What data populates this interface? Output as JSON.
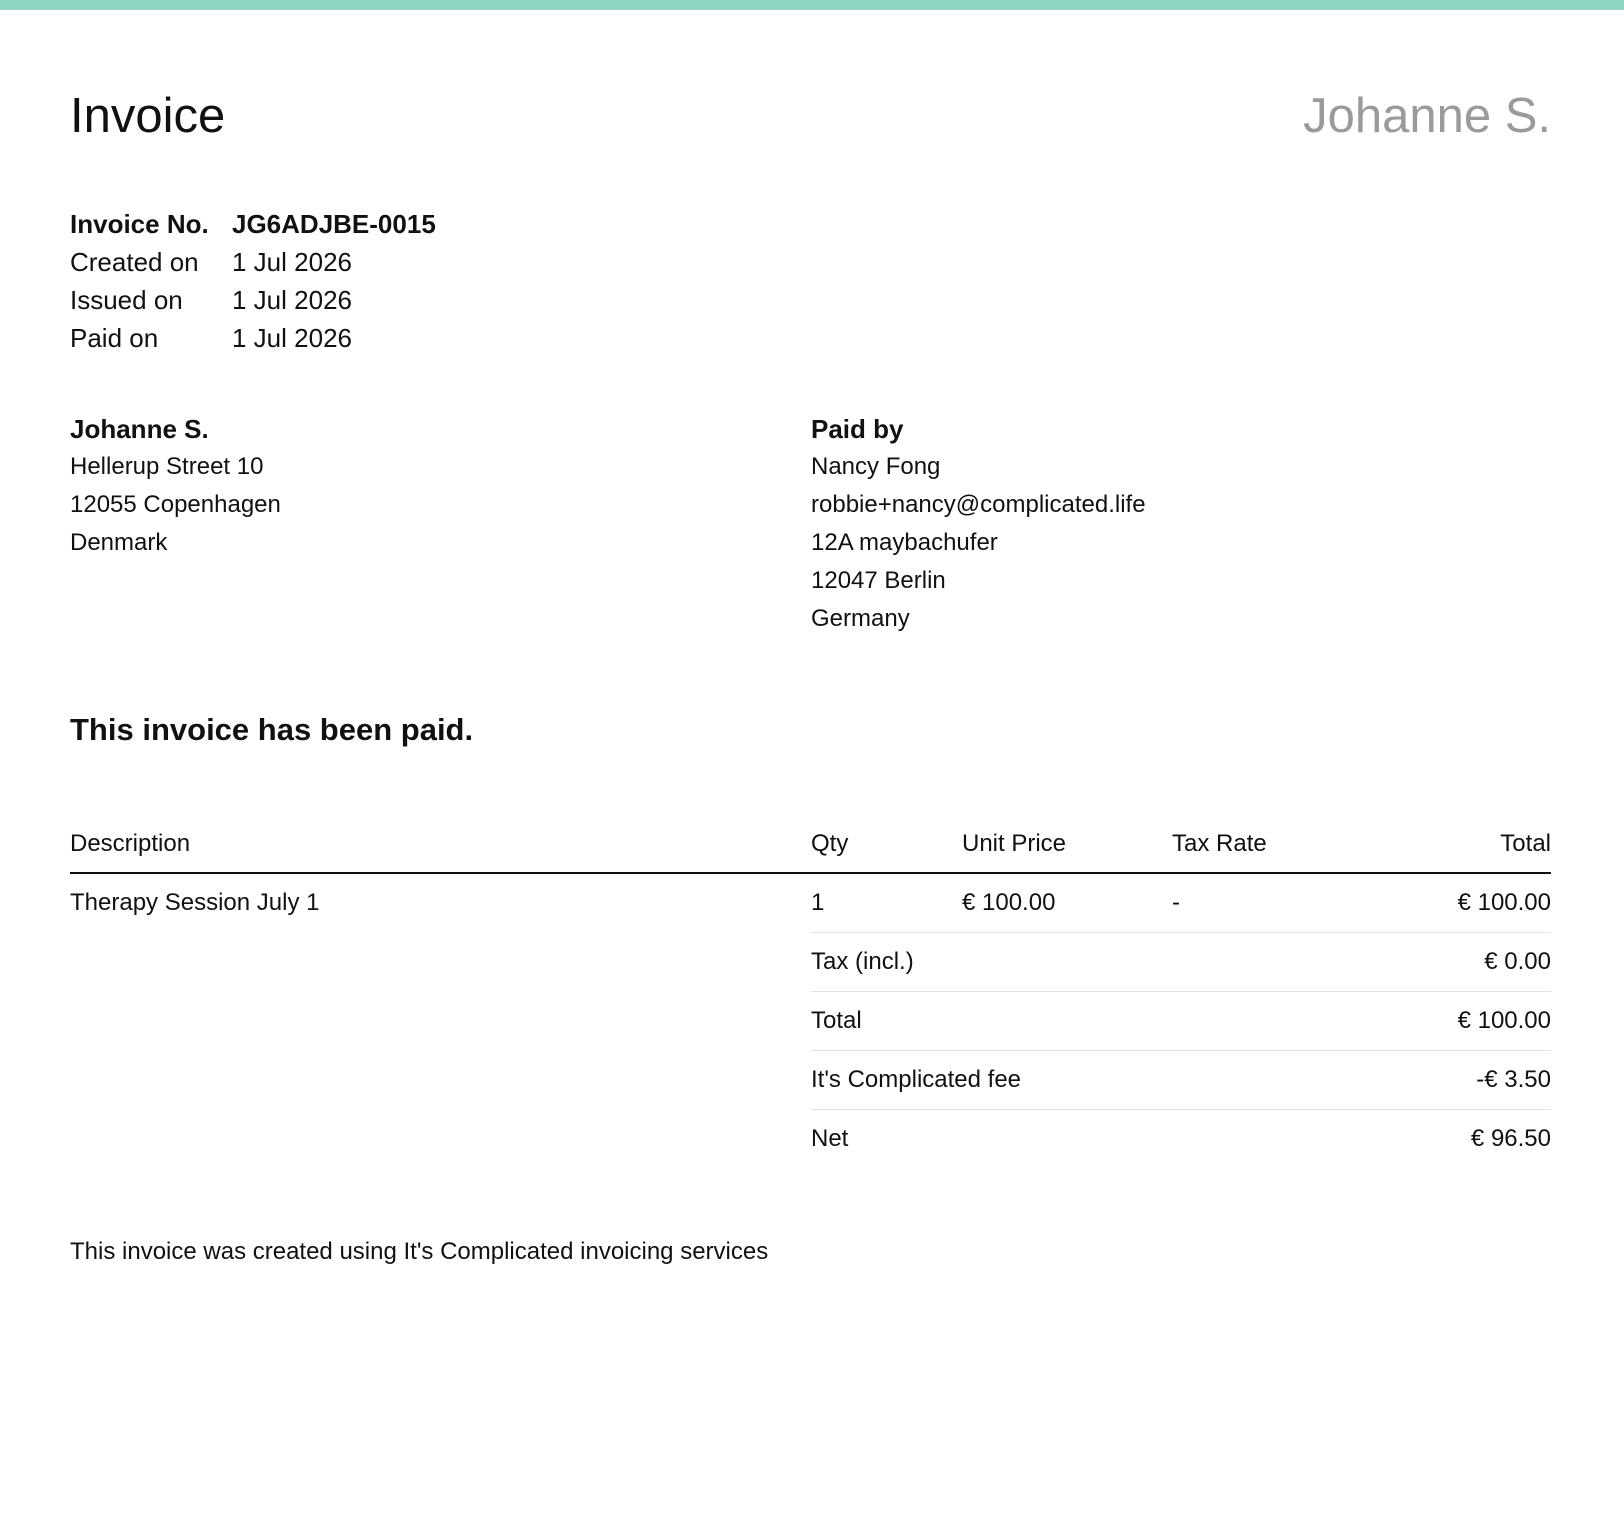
{
  "header": {
    "title": "Invoice",
    "brand": "Johanne S."
  },
  "meta": {
    "invoice_no_label": "Invoice No.",
    "invoice_no": "JG6ADJBE-0015",
    "created_label": "Created on",
    "created": "1 Jul 2026",
    "issued_label": "Issued on",
    "issued": "1 Jul 2026",
    "paid_label": "Paid on",
    "paid": "1 Jul 2026"
  },
  "seller": {
    "name": "Johanne S.",
    "address_lines": [
      "Hellerup Street 10",
      "12055 Copenhagen",
      "Denmark"
    ]
  },
  "buyer": {
    "title": "Paid by",
    "lines": [
      "Nancy Fong",
      "robbie+nancy@complicated.life",
      "12A maybachufer",
      "12047 Berlin",
      "Germany"
    ]
  },
  "status_message": "This invoice has been paid.",
  "table": {
    "headers": {
      "description": "Description",
      "qty": "Qty",
      "unit_price": "Unit Price",
      "tax_rate": "Tax Rate",
      "total": "Total"
    },
    "rows": [
      {
        "description": "Therapy Session July 1",
        "qty": "1",
        "unit_price": "€ 100.00",
        "tax_rate": "-",
        "total": "€ 100.00"
      }
    ],
    "summary": [
      {
        "label": "Tax (incl.)",
        "value": "€ 0.00"
      },
      {
        "label": "Total",
        "value": "€ 100.00"
      },
      {
        "label": "It's Complicated fee",
        "value": "-€ 3.50"
      },
      {
        "label": "Net",
        "value": "€ 96.50"
      }
    ]
  },
  "footer": {
    "note": "This invoice was created using It's Complicated invoicing services"
  },
  "colors": {
    "accent_bar": "#8fd3c1",
    "brand_text": "#9a9a9a"
  }
}
